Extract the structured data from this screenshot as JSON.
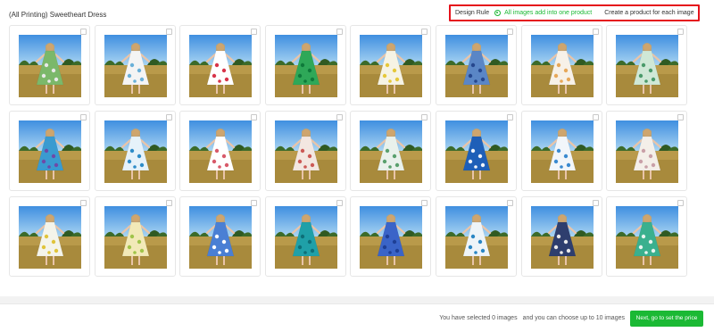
{
  "title": "(All Printing) Sweetheart Dress",
  "design_rule": {
    "label": "Design Rule",
    "option_selected": "All images add into one product",
    "option_other": "Create a product for each image"
  },
  "colors": {
    "accent": "#1bb934",
    "highlight_border": "#e5121b"
  },
  "images": [
    {
      "dress": "#7bb86a",
      "pattern": "#e8e8e8"
    },
    {
      "dress": "#f4f4f4",
      "pattern": "#6ab0d8"
    },
    {
      "dress": "#ffffff",
      "pattern": "#d8344a"
    },
    {
      "dress": "#2ea858",
      "pattern": "#0e7a3a"
    },
    {
      "dress": "#f6f3e4",
      "pattern": "#e6c83a"
    },
    {
      "dress": "#5a86c6",
      "pattern": "#26478e"
    },
    {
      "dress": "#f7f1e8",
      "pattern": "#e7a85a"
    },
    {
      "dress": "#cfe8d6",
      "pattern": "#4a9a6a"
    },
    {
      "dress": "#3a9bd0",
      "pattern": "#6e4aa8"
    },
    {
      "dress": "#e6f2fa",
      "pattern": "#2e8cc8"
    },
    {
      "dress": "#ffffff",
      "pattern": "#d85a6a"
    },
    {
      "dress": "#f3e7e1",
      "pattern": "#cc5a56"
    },
    {
      "dress": "#e9f1ec",
      "pattern": "#5aa06e"
    },
    {
      "dress": "#1e5fb8",
      "pattern": "#f0f4fa"
    },
    {
      "dress": "#f2f6fa",
      "pattern": "#3a8ad0"
    },
    {
      "dress": "#f4efe9",
      "pattern": "#c9a0a8"
    },
    {
      "dress": "#f4f4ea",
      "pattern": "#e0c43a"
    },
    {
      "dress": "#f2e9b8",
      "pattern": "#a0c44a"
    },
    {
      "dress": "#4a7fd4",
      "pattern": "#ffffff"
    },
    {
      "dress": "#1fa0a8",
      "pattern": "#0e6f78"
    },
    {
      "dress": "#3a64c8",
      "pattern": "#1e3f96"
    },
    {
      "dress": "#eef4f8",
      "pattern": "#2a86c4"
    },
    {
      "dress": "#2e3e6e",
      "pattern": "#eaeaea"
    },
    {
      "dress": "#3ab08e",
      "pattern": "#e8f4ee"
    }
  ],
  "footer": {
    "selected_text": "You have selected 0 images",
    "limit_text": "and you can choose up to 10 images",
    "next_button": "Next, go to set the price"
  }
}
